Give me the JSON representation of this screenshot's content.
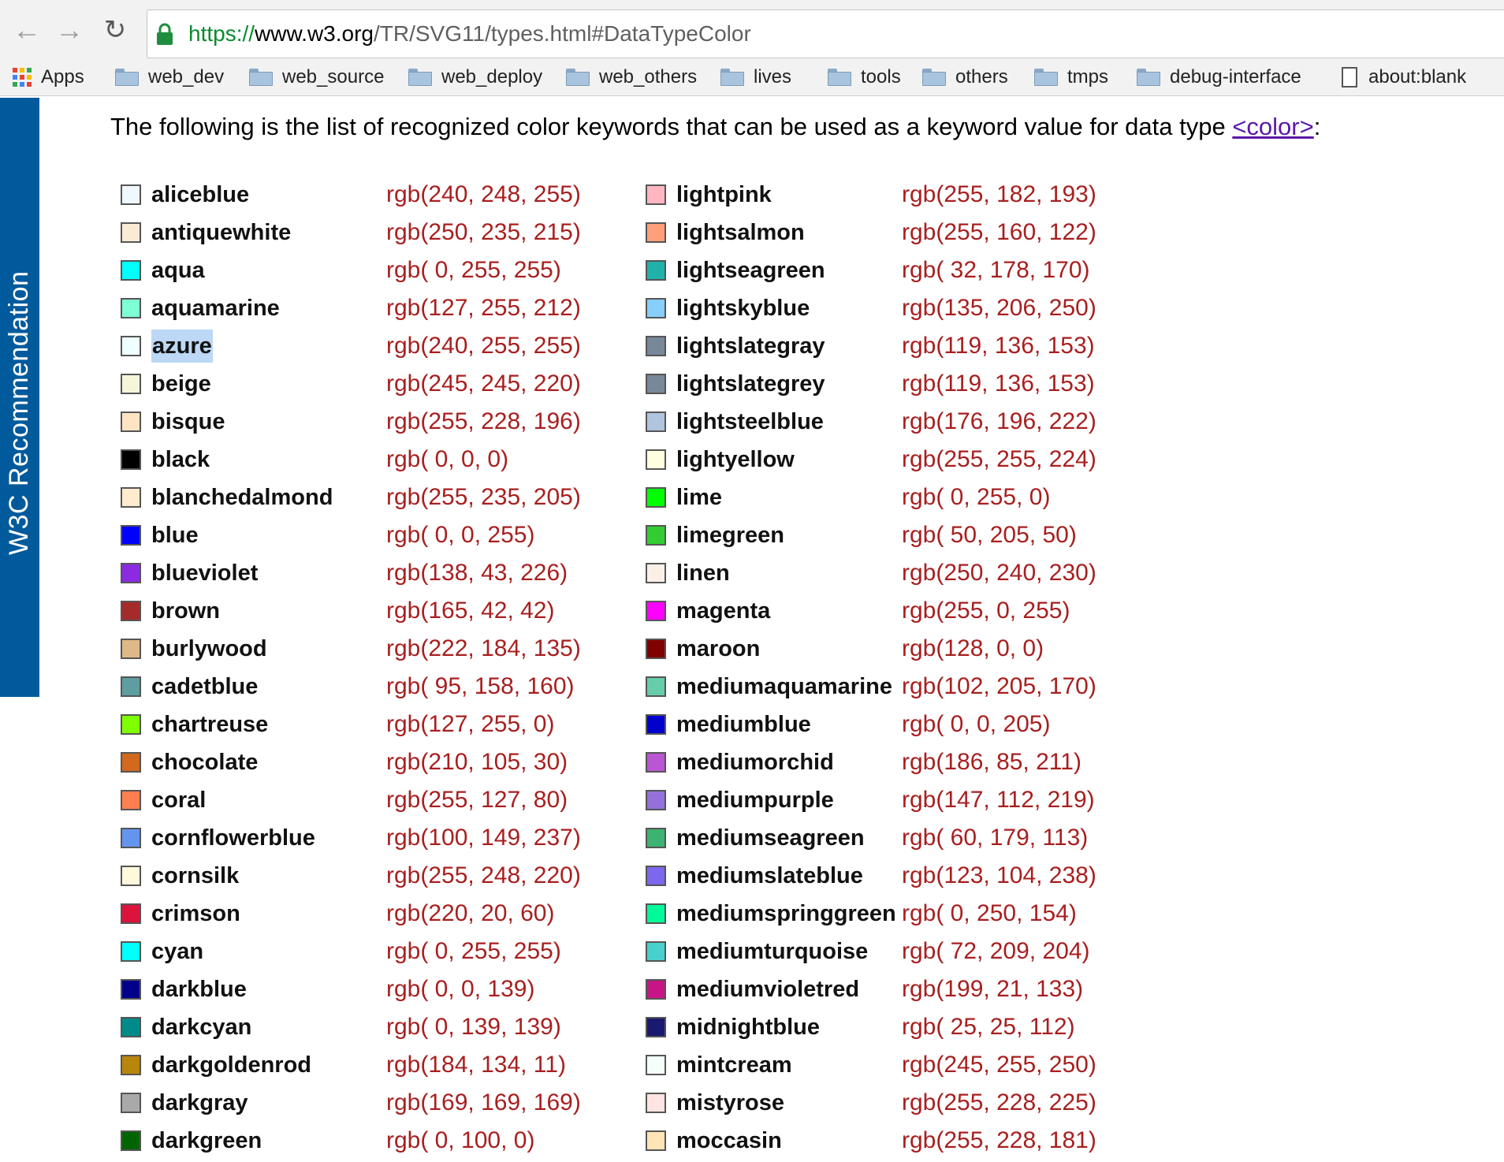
{
  "browser": {
    "url": {
      "scheme": "https://",
      "host": "www.w3.org",
      "path": "/TR/SVG11/types.html#DataTypeColor"
    }
  },
  "bookmarks": [
    {
      "label": "Apps",
      "icon": "apps-grid-icon"
    },
    {
      "label": "web_dev",
      "icon": "folder-icon"
    },
    {
      "label": "web_source",
      "icon": "folder-icon"
    },
    {
      "label": "web_deploy",
      "icon": "folder-icon"
    },
    {
      "label": "web_others",
      "icon": "folder-icon"
    },
    {
      "label": "lives",
      "icon": "folder-icon"
    },
    {
      "label": "tools",
      "icon": "folder-icon"
    },
    {
      "label": "others",
      "icon": "folder-icon"
    },
    {
      "label": "tmps",
      "icon": "folder-icon"
    },
    {
      "label": "debug-interface",
      "icon": "folder-icon"
    },
    {
      "label": "about:blank",
      "icon": "page-icon"
    }
  ],
  "sidetab": {
    "label": "W3C Recommendation"
  },
  "intro": {
    "text": "The following is the list of recognized color keywords that can be used as a keyword value for data type ",
    "link": "<color>",
    "suffix": ":"
  },
  "colors_left": [
    {
      "name": "aliceblue",
      "value": "rgb(240, 248, 255)",
      "hex": "#f0f8ff"
    },
    {
      "name": "antiquewhite",
      "value": "rgb(250, 235, 215)",
      "hex": "#faebd7"
    },
    {
      "name": "aqua",
      "value": "rgb( 0, 255, 255)",
      "hex": "#00ffff"
    },
    {
      "name": "aquamarine",
      "value": "rgb(127, 255, 212)",
      "hex": "#7fffd4"
    },
    {
      "name": "azure",
      "value": "rgb(240, 255, 255)",
      "hex": "#f0ffff",
      "selected": true
    },
    {
      "name": "beige",
      "value": "rgb(245, 245, 220)",
      "hex": "#f5f5dc"
    },
    {
      "name": "bisque",
      "value": "rgb(255, 228, 196)",
      "hex": "#ffe4c4"
    },
    {
      "name": "black",
      "value": "rgb( 0, 0, 0)",
      "hex": "#000000"
    },
    {
      "name": "blanchedalmond",
      "value": "rgb(255, 235, 205)",
      "hex": "#ffebcd"
    },
    {
      "name": "blue",
      "value": "rgb( 0, 0, 255)",
      "hex": "#0000ff"
    },
    {
      "name": "blueviolet",
      "value": "rgb(138, 43, 226)",
      "hex": "#8a2be2"
    },
    {
      "name": "brown",
      "value": "rgb(165, 42, 42)",
      "hex": "#a52a2a"
    },
    {
      "name": "burlywood",
      "value": "rgb(222, 184, 135)",
      "hex": "#deb887"
    },
    {
      "name": "cadetblue",
      "value": "rgb( 95, 158, 160)",
      "hex": "#5f9ea0"
    },
    {
      "name": "chartreuse",
      "value": "rgb(127, 255, 0)",
      "hex": "#7fff00"
    },
    {
      "name": "chocolate",
      "value": "rgb(210, 105, 30)",
      "hex": "#d2691e"
    },
    {
      "name": "coral",
      "value": "rgb(255, 127, 80)",
      "hex": "#ff7f50"
    },
    {
      "name": "cornflowerblue",
      "value": "rgb(100, 149, 237)",
      "hex": "#6495ed"
    },
    {
      "name": "cornsilk",
      "value": "rgb(255, 248, 220)",
      "hex": "#fff8dc"
    },
    {
      "name": "crimson",
      "value": "rgb(220, 20, 60)",
      "hex": "#dc143c"
    },
    {
      "name": "cyan",
      "value": "rgb( 0, 255, 255)",
      "hex": "#00ffff"
    },
    {
      "name": "darkblue",
      "value": "rgb( 0, 0, 139)",
      "hex": "#00008b"
    },
    {
      "name": "darkcyan",
      "value": "rgb( 0, 139, 139)",
      "hex": "#008b8b"
    },
    {
      "name": "darkgoldenrod",
      "value": "rgb(184, 134, 11)",
      "hex": "#b8860b"
    },
    {
      "name": "darkgray",
      "value": "rgb(169, 169, 169)",
      "hex": "#a9a9a9"
    },
    {
      "name": "darkgreen",
      "value": "rgb( 0, 100, 0)",
      "hex": "#006400"
    }
  ],
  "colors_right": [
    {
      "name": "lightpink",
      "value": "rgb(255, 182, 193)",
      "hex": "#ffb6c1"
    },
    {
      "name": "lightsalmon",
      "value": "rgb(255, 160, 122)",
      "hex": "#ffa07a"
    },
    {
      "name": "lightseagreen",
      "value": "rgb( 32, 178, 170)",
      "hex": "#20b2aa"
    },
    {
      "name": "lightskyblue",
      "value": "rgb(135, 206, 250)",
      "hex": "#87cefa"
    },
    {
      "name": "lightslategray",
      "value": "rgb(119, 136, 153)",
      "hex": "#778899"
    },
    {
      "name": "lightslategrey",
      "value": "rgb(119, 136, 153)",
      "hex": "#778899"
    },
    {
      "name": "lightsteelblue",
      "value": "rgb(176, 196, 222)",
      "hex": "#b0c4de"
    },
    {
      "name": "lightyellow",
      "value": "rgb(255, 255, 224)",
      "hex": "#ffffe0"
    },
    {
      "name": "lime",
      "value": "rgb( 0, 255, 0)",
      "hex": "#00ff00"
    },
    {
      "name": "limegreen",
      "value": "rgb( 50, 205, 50)",
      "hex": "#32cd32"
    },
    {
      "name": "linen",
      "value": "rgb(250, 240, 230)",
      "hex": "#faf0e6"
    },
    {
      "name": "magenta",
      "value": "rgb(255, 0, 255)",
      "hex": "#ff00ff"
    },
    {
      "name": "maroon",
      "value": "rgb(128, 0, 0)",
      "hex": "#800000"
    },
    {
      "name": "mediumaquamarine",
      "value": "rgb(102, 205, 170)",
      "hex": "#66cdaa"
    },
    {
      "name": "mediumblue",
      "value": "rgb( 0, 0, 205)",
      "hex": "#0000cd"
    },
    {
      "name": "mediumorchid",
      "value": "rgb(186, 85, 211)",
      "hex": "#ba55d3"
    },
    {
      "name": "mediumpurple",
      "value": "rgb(147, 112, 219)",
      "hex": "#9370db"
    },
    {
      "name": "mediumseagreen",
      "value": "rgb( 60, 179, 113)",
      "hex": "#3cb371"
    },
    {
      "name": "mediumslateblue",
      "value": "rgb(123, 104, 238)",
      "hex": "#7b68ee"
    },
    {
      "name": "mediumspringgreen",
      "value": "rgb( 0, 250, 154)",
      "hex": "#00fa9a"
    },
    {
      "name": "mediumturquoise",
      "value": "rgb( 72, 209, 204)",
      "hex": "#48d1cc"
    },
    {
      "name": "mediumvioletred",
      "value": "rgb(199, 21, 133)",
      "hex": "#c71585"
    },
    {
      "name": "midnightblue",
      "value": "rgb( 25, 25, 112)",
      "hex": "#191970"
    },
    {
      "name": "mintcream",
      "value": "rgb(245, 255, 250)",
      "hex": "#f5fffa"
    },
    {
      "name": "mistyrose",
      "value": "rgb(255, 228, 225)",
      "hex": "#ffe4e1"
    },
    {
      "name": "moccasin",
      "value": "rgb(255, 228, 181)",
      "hex": "#ffe4b5"
    }
  ]
}
